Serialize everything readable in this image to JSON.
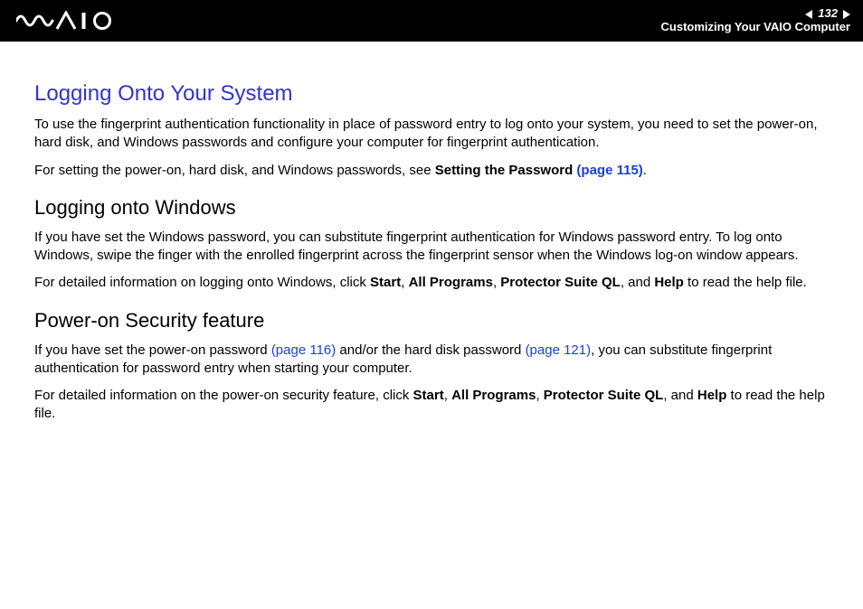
{
  "header": {
    "page_number": "132",
    "breadcrumb": "Customizing Your VAIO Computer"
  },
  "section1": {
    "title": "Logging Onto Your System",
    "p1": "To use the fingerprint authentication functionality in place of password entry to log onto your system, you need to set the power-on, hard disk, and Windows passwords and configure your computer for fingerprint authentication.",
    "p2_a": "For setting the power-on, hard disk, and Windows passwords, see ",
    "p2_b": "Setting the Password ",
    "p2_link": "(page 115)",
    "p2_c": "."
  },
  "section2": {
    "title": "Logging onto Windows",
    "p1": "If you have set the Windows password, you can substitute fingerprint authentication for Windows password entry. To log onto Windows, swipe the finger with the enrolled fingerprint across the fingerprint sensor when the Windows log-on window appears.",
    "p2_a": "For detailed information on logging onto Windows, click ",
    "start": "Start",
    "comma1": ", ",
    "allprograms": "All Programs",
    "comma2": ", ",
    "protector": "Protector Suite QL",
    "comma3": ", and ",
    "help": "Help",
    "p2_b": " to read the help file."
  },
  "section3": {
    "title": "Power-on Security feature",
    "p1_a": "If you have set the power-on password ",
    "p1_link1": "(page 116)",
    "p1_b": " and/or the hard disk password ",
    "p1_link2": "(page 121)",
    "p1_c": ", you can substitute fingerprint authentication for password entry when starting your computer.",
    "p2_a": "For detailed information on the power-on security feature, click ",
    "start": "Start",
    "comma1": ", ",
    "allprograms": "All Programs",
    "comma2": ", ",
    "protector": "Protector Suite QL",
    "comma3": ", and ",
    "help": "Help",
    "p2_b": " to read the help file."
  }
}
